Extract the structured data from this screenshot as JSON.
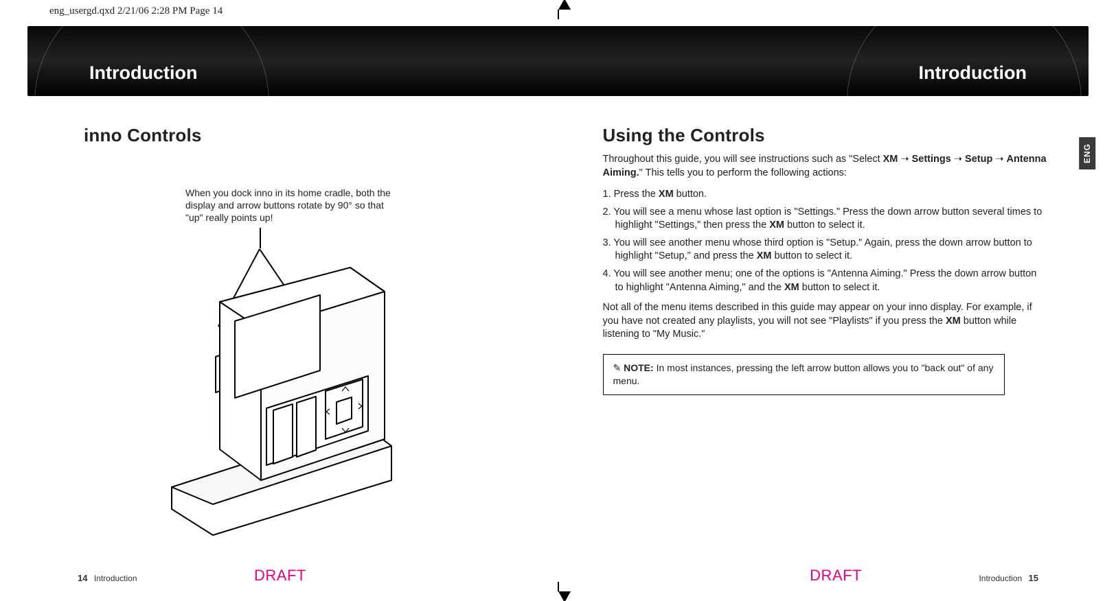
{
  "slug": "eng_usergd.qxd  2/21/06  2:28 PM  Page 14",
  "banner": {
    "left": "Introduction",
    "right": "Introduction"
  },
  "left": {
    "heading": "inno Controls",
    "caption": "When you dock inno in its home cradle, both the display and arrow buttons rotate by 90° so that \"up\" really points up!"
  },
  "right": {
    "heading": "Using the Controls",
    "intro_pre": "Throughout this guide, you will see instructions such as \"Select ",
    "intro_b1": "XM",
    "intro_a1": " ➝ ",
    "intro_b2": "Settings",
    "intro_a2": " ➝ ",
    "intro_b3": "Setup",
    "intro_a3": " ➝ ",
    "intro_b4": "Antenna Aiming.",
    "intro_post": "\" This tells you to perform the following actions:",
    "step1_pre": "1. Press the ",
    "step1_b": "XM",
    "step1_post": " button.",
    "step2_pre": "2. You will see a menu whose last option is \"Settings.\" Press the down arrow button several times to highlight \"Settings,\" then press the ",
    "step2_b": "XM",
    "step2_post": " button to select it.",
    "step3_pre": "3. You will see another menu whose third option is \"Setup.\" Again, press the down arrow button to highlight \"Setup,\" and press the ",
    "step3_b": "XM",
    "step3_post": " button to select it.",
    "step4_pre": "4. You will see another menu; one of the options is \"Antenna Aiming.\" Press the down arrow button to highlight \"Antenna Aiming,\" and the ",
    "step4_b": "XM",
    "step4_post": " button to select it.",
    "followup_pre": "Not all of the menu items described in this guide may appear on your inno display. For example, if you have not created any playlists, you will not see \"Playlists\" if you press the ",
    "followup_b": "XM",
    "followup_post": " button while listening to \"My Music.\"",
    "note_lead": "✎ ",
    "note_label": "NOTE: ",
    "note_body": "In most instances, pressing the left arrow button allows you to \"back out\" of any menu."
  },
  "footer": {
    "draft": "DRAFT",
    "section": "Introduction",
    "page_left": "14",
    "page_right": "15",
    "lang_tab": "ENG"
  }
}
